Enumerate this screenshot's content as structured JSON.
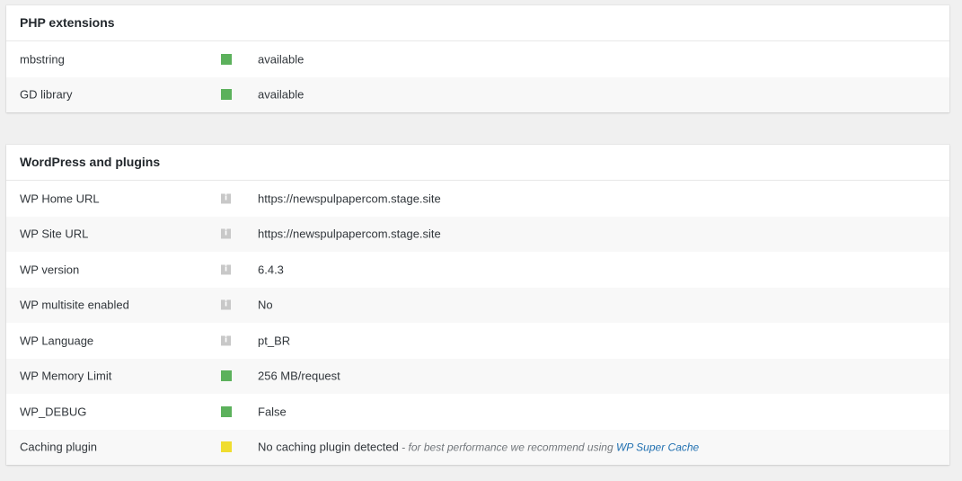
{
  "php_extensions": {
    "title": "PHP extensions",
    "rows": [
      {
        "label": "mbstring",
        "status": "ok",
        "value": "available"
      },
      {
        "label": "GD library",
        "status": "ok",
        "value": "available"
      }
    ]
  },
  "wordpress": {
    "title": "WordPress and plugins",
    "info_glyph": "i",
    "rows": [
      {
        "label": "WP Home URL",
        "status": "info",
        "value": "https://newspulpapercom.stage.site"
      },
      {
        "label": "WP Site URL",
        "status": "info",
        "value": "https://newspulpapercom.stage.site"
      },
      {
        "label": "WP version",
        "status": "info",
        "value": "6.4.3"
      },
      {
        "label": "WP multisite enabled",
        "status": "info",
        "value": "No"
      },
      {
        "label": "WP Language",
        "status": "info",
        "value": "pt_BR"
      },
      {
        "label": "WP Memory Limit",
        "status": "ok",
        "value": "256 MB/request"
      },
      {
        "label": "WP_DEBUG",
        "status": "ok",
        "value": "False"
      },
      {
        "label": "Caching plugin",
        "status": "warn",
        "value": "No caching plugin detected",
        "hint": " - for best performance we recommend using ",
        "link": "WP Super Cache"
      }
    ]
  },
  "colors": {
    "ok": "#5cb15c",
    "warn": "#f0dd30",
    "info": "#c8c8c8",
    "link": "#2271b1"
  }
}
